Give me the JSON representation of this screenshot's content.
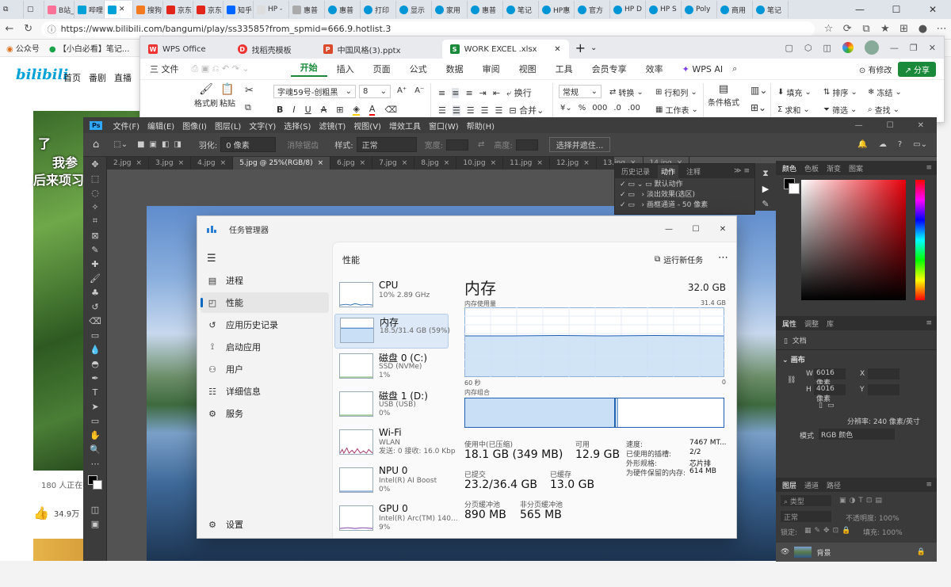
{
  "browser": {
    "tabs": [
      "B站_",
      "哔哩",
      "",
      "搜狗",
      "京东",
      "京东",
      "知乎",
      "HP -",
      "惠普",
      "惠普",
      "打印",
      "显示",
      "家用",
      "惠普",
      "笔记",
      "HP惠",
      "官方",
      "HP D",
      "HP S",
      "Poly",
      "商用",
      "笔记"
    ],
    "url": "https://www.bilibili.com/bangumi/play/ss33585?from_spmid=666.9.hotlist.3",
    "bookmarks": [
      "公众号",
      "【小白必看】笔记..."
    ]
  },
  "bilibili": {
    "logo": "bilibili",
    "nav": [
      "首页",
      "番剧",
      "直播"
    ],
    "subtitle_1": "了",
    "subtitle_2": "我参",
    "subtitle_3": "后来项习",
    "viewers": "180 人正在看",
    "likes": "34.9万"
  },
  "wps": {
    "tabs": [
      "WPS Office",
      "找稻壳模板",
      "中国风格(3).pptx",
      "WORK EXCEL .xlsx"
    ],
    "menu": [
      "三 文件",
      "开始",
      "插入",
      "页面",
      "公式",
      "数据",
      "审阅",
      "视图",
      "工具",
      "会员专享",
      "效率",
      "WPS AI"
    ],
    "active_menu": "开始",
    "right": {
      "modify": "有修改",
      "share": "分享"
    },
    "ribbon": {
      "format_brush": "格式刷",
      "paste": "粘贴",
      "font": "字魂59号-创粗黑",
      "size": "8",
      "wrap": "换行",
      "merge": "合并",
      "number_format": "常规",
      "convert": "转换",
      "row_col": "行和列",
      "worksheet": "工作表",
      "cond_format": "条件格式",
      "fill": "填充",
      "sort": "排序",
      "freeze": "冻结",
      "sum": "求和",
      "filter": "筛选",
      "find": "查找"
    }
  },
  "photoshop": {
    "menu": [
      "文件(F)",
      "编辑(E)",
      "图像(I)",
      "图层(L)",
      "文字(Y)",
      "选择(S)",
      "滤镜(T)",
      "视图(V)",
      "增效工具",
      "窗口(W)",
      "帮助(H)"
    ],
    "options": {
      "feather": "羽化:",
      "feather_val": "0 像素",
      "antialias": "消除锯齿",
      "style": "样式:",
      "style_val": "正常",
      "width": "宽度:",
      "height": "高度:",
      "select_subject": "选择并遮住..."
    },
    "doc_tabs": [
      "2.jpg",
      "3.jpg",
      "4.jpg",
      "5.jpg @ 25%(RGB/8)",
      "6.jpg",
      "7.jpg",
      "8.jpg",
      "10.jpg",
      "11.jpg",
      "12.jpg",
      "13.jpg",
      "14.jpg"
    ],
    "active_doc": "5.jpg @ 25%(RGB/8)",
    "history_tabs": [
      "历史记录",
      "动作",
      "注释"
    ],
    "actions": [
      "默认动作",
      "淡出效果(选区)",
      "画框通道 - 50 像素"
    ],
    "color_tabs": [
      "颜色",
      "色板",
      "渐变",
      "图案"
    ],
    "props_tabs": [
      "属性",
      "调整",
      "库"
    ],
    "props": {
      "doc": "文档",
      "canvas": "画布",
      "w_label": "W",
      "w_val": "6016 像素",
      "h_label": "H",
      "h_val": "4016 像素",
      "x": "X",
      "y": "Y",
      "resolution": "分辨率: 240 像素/英寸",
      "mode_label": "模式",
      "mode_val": "RGB 颜色"
    },
    "layer_tabs": [
      "图层",
      "通道",
      "路径"
    ],
    "layer_search": "类型",
    "layer_mode": "正常",
    "opacity": "不透明度: 100%",
    "lock": "锁定:",
    "fill": "填充: 100%",
    "layer_name": "背景"
  },
  "taskmgr": {
    "title": "任务管理器",
    "nav": [
      "进程",
      "性能",
      "应用历史记录",
      "启动应用",
      "用户",
      "详细信息",
      "服务"
    ],
    "nav_icons": [
      "processes-icon",
      "performance-icon",
      "history-icon",
      "startup-icon",
      "users-icon",
      "details-icon",
      "services-icon"
    ],
    "selected_nav": "性能",
    "settings": "设置",
    "header": "性能",
    "run_task": "运行新任务",
    "resources": [
      {
        "name": "CPU",
        "sub1": "10%  2.89 GHz",
        "sub2": ""
      },
      {
        "name": "内存",
        "sub1": "18.5/31.4 GB (59%)",
        "sub2": ""
      },
      {
        "name": "磁盘 0 (C:)",
        "sub1": "SSD (NVMe)",
        "sub2": "1%"
      },
      {
        "name": "磁盘 1 (D:)",
        "sub1": "USB (USB)",
        "sub2": "0%"
      },
      {
        "name": "Wi-Fi",
        "sub1": "WLAN",
        "sub2": "发送: 0 接收: 16.0 Kbp"
      },
      {
        "name": "NPU 0",
        "sub1": "Intel(R) AI Boost",
        "sub2": "0%"
      },
      {
        "name": "GPU 0",
        "sub1": "Intel(R) Arc(TM) 140...",
        "sub2": "9%"
      }
    ],
    "detail": {
      "title": "内存",
      "total": "32.0 GB",
      "usage_label": "内存使用量",
      "usage_max": "31.4 GB",
      "x_left": "60 秒",
      "x_right": "0",
      "composition_label": "内存组合",
      "in_use_label": "使用中(已压缩)",
      "in_use": "18.1 GB (349 MB)",
      "available_label": "可用",
      "available": "12.9 GB",
      "committed_label": "已提交",
      "committed": "23.2/36.4 GB",
      "cached_label": "已缓存",
      "cached": "13.0 GB",
      "paged_label": "分页缓冲池",
      "paged": "890 MB",
      "nonpaged_label": "非分页缓冲池",
      "nonpaged": "565 MB",
      "speed_label": "速度:",
      "speed": "7467 MT...",
      "slots_label": "已使用的插槽:",
      "slots": "2/2",
      "form_label": "外形规格:",
      "form": "芯片排",
      "reserved_label": "为硬件保留的内存:",
      "reserved": "614 MB"
    }
  },
  "colors": {
    "bili_blue": "#00a1d6",
    "wps_green": "#1a8a3a",
    "tm_accent": "#0067c0",
    "mem_fill": "#c9dff5",
    "mem_line": "#1e5fb4"
  }
}
